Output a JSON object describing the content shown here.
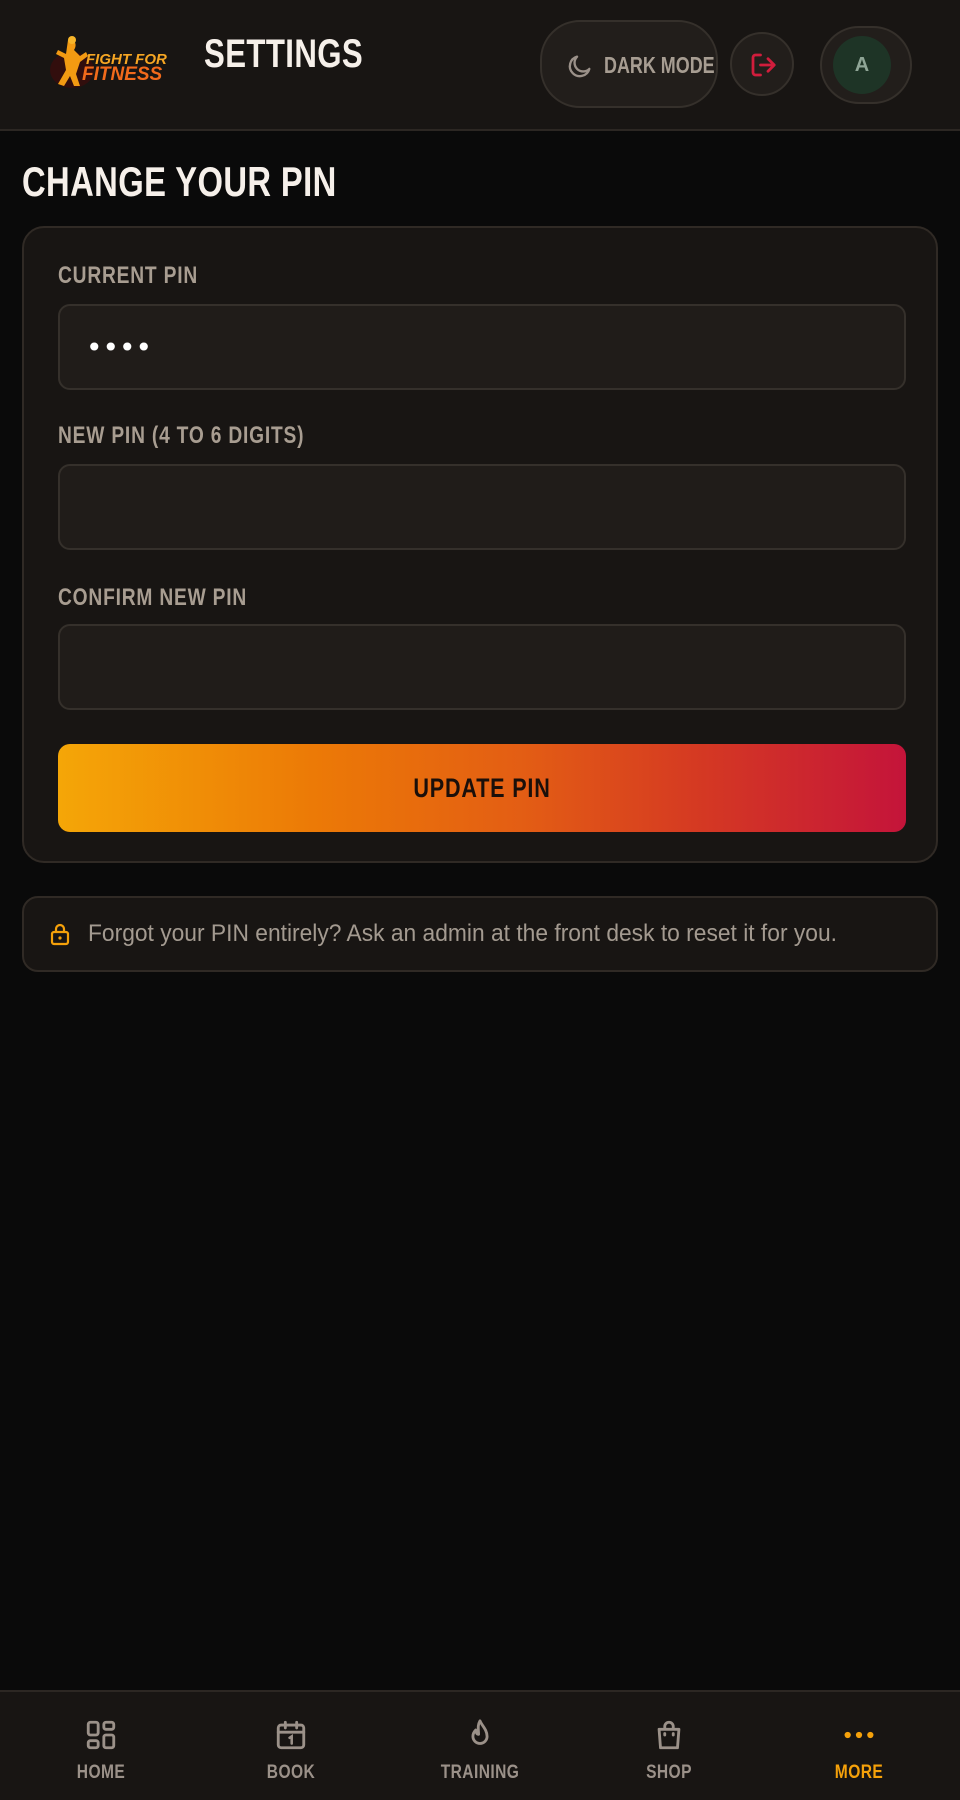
{
  "header": {
    "logo_text_top": "FIGHT FOR",
    "logo_text_bottom": "FITNESS",
    "title": "SETTINGS",
    "dark_mode_label": "DARK MODE",
    "avatar_initial": "A"
  },
  "main": {
    "section_title": "CHANGE YOUR PIN",
    "fields": [
      {
        "label": "CURRENT PIN",
        "value": "••••",
        "type": "password"
      },
      {
        "label": "NEW PIN (4 TO 6 DIGITS)",
        "value": "",
        "type": "password"
      },
      {
        "label": "CONFIRM NEW PIN",
        "value": "",
        "type": "password"
      }
    ],
    "submit_label": "UPDATE PIN",
    "notice": "Forgot your PIN entirely? Ask an admin at the front desk to reset it for you."
  },
  "bottom_nav": {
    "items": [
      {
        "label": "HOME",
        "icon": "grid-icon",
        "active": false
      },
      {
        "label": "BOOK",
        "icon": "calendar-icon",
        "active": false
      },
      {
        "label": "TRAINING",
        "icon": "flame-icon",
        "active": false
      },
      {
        "label": "SHOP",
        "icon": "shopping-bag-icon",
        "active": false
      },
      {
        "label": "MORE",
        "icon": "more-dots-icon",
        "active": true
      }
    ]
  },
  "colors": {
    "background": "#0a0a0a",
    "surface": "#181513",
    "accent": "#f5a10a",
    "danger": "#c4143a",
    "gradient_start": "#f5a607",
    "gradient_end": "#c4143a"
  }
}
